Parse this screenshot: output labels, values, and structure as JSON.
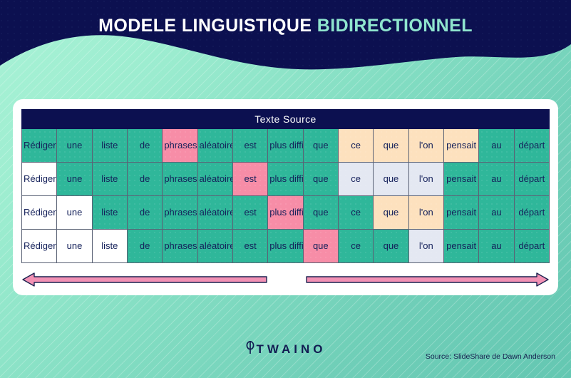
{
  "header": {
    "title_main": "MODELE LINGUISTIQUE",
    "title_accent": "BIDIRECTIONNEL",
    "wave_color": "#0C1050",
    "accent_color": "#8FE5CE"
  },
  "table": {
    "header_label": "Texte Source",
    "columns": [
      "Rédiger",
      "une",
      "liste",
      "de",
      "phrases",
      "aléatoires",
      "est",
      "plus difficile",
      "que",
      "ce",
      "que",
      "l'on",
      "pensait",
      "au",
      "départ"
    ],
    "legend_colors": {
      "teal": "#2FB79A",
      "pink": "#F78DA7",
      "peach": "#FDE1BE",
      "lavender": "#E4E8F2",
      "white": "#FFFFFF",
      "header_navy": "#0C1050",
      "text": "#14205A"
    },
    "rows": [
      {
        "cells": [
          {
            "text": "Rédiger",
            "color": "teal"
          },
          {
            "text": "une",
            "color": "teal"
          },
          {
            "text": "liste",
            "color": "teal"
          },
          {
            "text": "de",
            "color": "teal"
          },
          {
            "text": "phrases",
            "color": "pink"
          },
          {
            "text": "aléatoires",
            "color": "teal"
          },
          {
            "text": "est",
            "color": "teal"
          },
          {
            "text": "plus difficile",
            "color": "teal"
          },
          {
            "text": "que",
            "color": "teal"
          },
          {
            "text": "ce",
            "color": "peach"
          },
          {
            "text": "que",
            "color": "peach"
          },
          {
            "text": "l'on",
            "color": "peach"
          },
          {
            "text": "pensait",
            "color": "peach"
          },
          {
            "text": "au",
            "color": "teal"
          },
          {
            "text": "départ",
            "color": "teal"
          }
        ]
      },
      {
        "cells": [
          {
            "text": "Rédiger",
            "color": "white"
          },
          {
            "text": "une",
            "color": "teal"
          },
          {
            "text": "liste",
            "color": "teal"
          },
          {
            "text": "de",
            "color": "teal"
          },
          {
            "text": "phrases",
            "color": "teal"
          },
          {
            "text": "aléatoires",
            "color": "teal"
          },
          {
            "text": "est",
            "color": "pink"
          },
          {
            "text": "plus difficile",
            "color": "teal"
          },
          {
            "text": "que",
            "color": "teal"
          },
          {
            "text": "ce",
            "color": "lavender"
          },
          {
            "text": "que",
            "color": "lavender"
          },
          {
            "text": "l'on",
            "color": "lavender"
          },
          {
            "text": "pensait",
            "color": "teal"
          },
          {
            "text": "au",
            "color": "teal"
          },
          {
            "text": "départ",
            "color": "teal"
          }
        ]
      },
      {
        "cells": [
          {
            "text": "Rédiger",
            "color": "white"
          },
          {
            "text": "une",
            "color": "white"
          },
          {
            "text": "liste",
            "color": "teal"
          },
          {
            "text": "de",
            "color": "teal"
          },
          {
            "text": "phrases",
            "color": "teal"
          },
          {
            "text": "aléatoires",
            "color": "teal"
          },
          {
            "text": "est",
            "color": "teal"
          },
          {
            "text": "plus difficile",
            "color": "pink"
          },
          {
            "text": "que",
            "color": "teal"
          },
          {
            "text": "ce",
            "color": "teal"
          },
          {
            "text": "que",
            "color": "peach"
          },
          {
            "text": "l'on",
            "color": "peach"
          },
          {
            "text": "pensait",
            "color": "teal"
          },
          {
            "text": "au",
            "color": "teal"
          },
          {
            "text": "départ",
            "color": "teal"
          }
        ]
      },
      {
        "cells": [
          {
            "text": "Rédiger",
            "color": "white"
          },
          {
            "text": "une",
            "color": "white"
          },
          {
            "text": "liste",
            "color": "white"
          },
          {
            "text": "de",
            "color": "teal"
          },
          {
            "text": "phrases",
            "color": "teal"
          },
          {
            "text": "aléatoires",
            "color": "teal"
          },
          {
            "text": "est",
            "color": "teal"
          },
          {
            "text": "plus difficile",
            "color": "teal"
          },
          {
            "text": "que",
            "color": "pink"
          },
          {
            "text": "ce",
            "color": "teal"
          },
          {
            "text": "que",
            "color": "teal"
          },
          {
            "text": "l'on",
            "color": "lavender"
          },
          {
            "text": "pensait",
            "color": "teal"
          },
          {
            "text": "au",
            "color": "teal"
          },
          {
            "text": "départ",
            "color": "teal"
          }
        ]
      }
    ]
  },
  "arrows": [
    {
      "name": "left-arrow",
      "direction": "left",
      "color": "#F291B4",
      "outline": "#1B2250"
    },
    {
      "name": "right-arrow",
      "direction": "right",
      "color": "#F291B4",
      "outline": "#1B2250"
    }
  ],
  "footer": {
    "logo_text": "TWAINO",
    "logo_mark": "twaino-glyph-icon",
    "source": "Source:  SlideShare de Dawn Anderson"
  }
}
